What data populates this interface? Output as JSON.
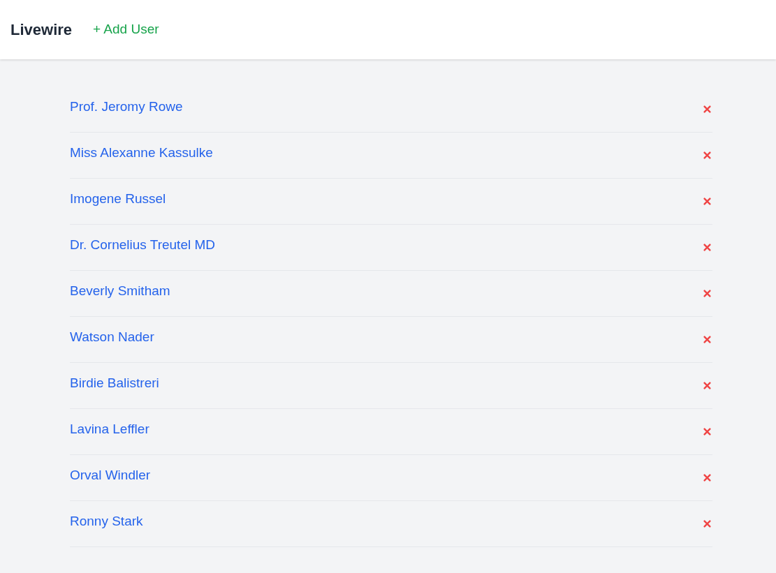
{
  "header": {
    "brand": "Livewire",
    "add_link": "+ Add User"
  },
  "users": [
    {
      "name": "Prof. Jeromy Rowe"
    },
    {
      "name": "Miss Alexanne Kassulke"
    },
    {
      "name": "Imogene Russel"
    },
    {
      "name": "Dr. Cornelius Treutel MD"
    },
    {
      "name": "Beverly Smitham"
    },
    {
      "name": "Watson Nader"
    },
    {
      "name": "Birdie Balistreri"
    },
    {
      "name": "Lavina Leffler"
    },
    {
      "name": "Orval Windler"
    },
    {
      "name": "Ronny Stark"
    }
  ]
}
